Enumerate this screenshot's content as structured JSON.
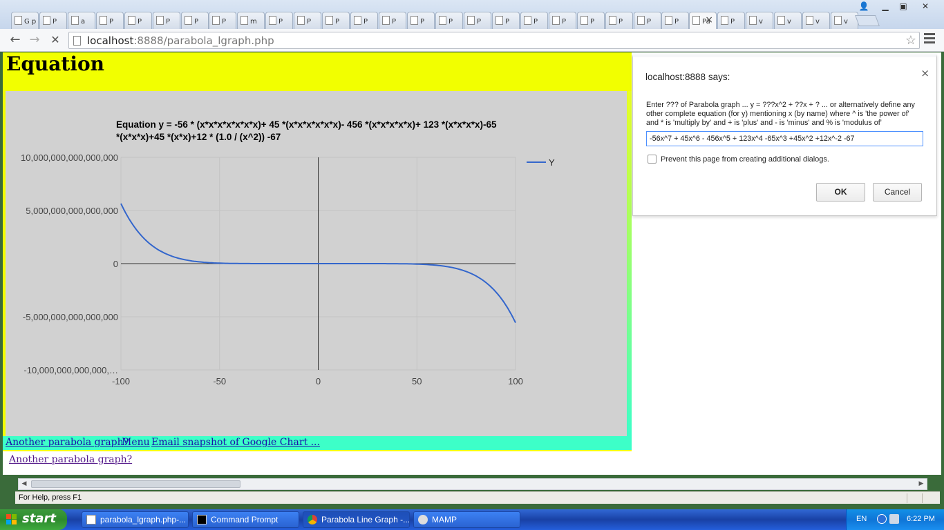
{
  "browser": {
    "tabs": [
      {
        "label": "G p"
      },
      {
        "label": "P"
      },
      {
        "label": "a"
      },
      {
        "label": "P"
      },
      {
        "label": "P"
      },
      {
        "label": "P"
      },
      {
        "label": "P"
      },
      {
        "label": "P"
      },
      {
        "label": "m"
      },
      {
        "label": "P"
      },
      {
        "label": "P"
      },
      {
        "label": "P"
      },
      {
        "label": "P"
      },
      {
        "label": "P"
      },
      {
        "label": "P"
      },
      {
        "label": "P"
      },
      {
        "label": "P"
      },
      {
        "label": "P"
      },
      {
        "label": "P"
      },
      {
        "label": "P"
      },
      {
        "label": "P"
      },
      {
        "label": "P"
      },
      {
        "label": "P"
      },
      {
        "label": "P"
      },
      {
        "label": "Pa"
      },
      {
        "label": "P"
      },
      {
        "label": "v"
      },
      {
        "label": "v"
      },
      {
        "label": "v"
      },
      {
        "label": "v"
      }
    ],
    "url_host": "localhost",
    "url_rest": ":8888/parabola_lgraph.php"
  },
  "page": {
    "title": "Equation",
    "links": {
      "another": "Another parabola graph?",
      "menu": "Menu",
      "email": "Email snapshot of Google Chart ...",
      "another_bottom": "Another parabola graph?"
    }
  },
  "chart_data": {
    "type": "line",
    "title_line1": "Equation y = -56 * (x*x*x*x*x*x*x)+ 45 *(x*x*x*x*x*x)- 456 *(x*x*x*x*x)+ 123 *(x*x*x*x)-65",
    "title_line2": "*(x*x*x)+45 *(x*x)+12 * (1.0 / (x^2)) -67",
    "x_ticks": [
      "-100",
      "-50",
      "0",
      "50",
      "100"
    ],
    "y_ticks": [
      "10,000,000,000,000,000",
      "5,000,000,000,000,000",
      "0",
      "-5,000,000,000,000,000",
      "-10,000,000,000,000,…"
    ],
    "xlim": [
      -100,
      100
    ],
    "ylim": [
      -10000000000000000,
      10000000000000000
    ],
    "legend_position": "right",
    "series": [
      {
        "name": "Y",
        "color": "#3366cc",
        "coefficients": {
          "x7": -56,
          "x6": 45,
          "x5": -456,
          "x4": 123,
          "x3": -65,
          "x2": 45,
          "xm2": 12,
          "c": -67
        },
        "x": [
          -100,
          -90,
          -80,
          -70,
          -60,
          -50,
          -40,
          -30,
          -20,
          -10,
          0,
          10,
          20,
          30,
          40,
          50,
          60,
          70,
          80,
          90,
          100
        ],
        "y": [
          5600000000000000.0,
          2690000000000000.0,
          1170000000000000.0,
          461000000000000.0,
          157000000000000.0,
          44500000000000.0,
          9300000000000.0,
          1260000000000.0,
          77300000000.0,
          606000000.0,
          -67,
          -516000000.0,
          -63000000000.0,
          -1140000000000.0,
          -8900000000000.0,
          -43100000000000.0,
          -155000000000000.0,
          -458000000000000.0,
          -1170000000000000.0,
          -2660000000000000.0,
          -5550000000000000.0
        ]
      }
    ]
  },
  "dialog": {
    "title": "localhost:8888 says:",
    "message": "Enter ??? of Parabola graph ... y = ???x^2 + ??x + ? ... or alternatively define any other complete equation (for y) mentioning x (by name) where ^ is 'the power of' and * is 'multiply by' and + is 'plus' and - is 'minus' and % is 'modulus of'",
    "input_value": "-56x^7 + 45x^6 - 456x^5 + 123x^4 -65x^3 +45x^2 +12x^-2 -67",
    "checkbox_label": "Prevent this page from creating additional dialogs.",
    "ok_label": "OK",
    "cancel_label": "Cancel",
    "close_glyph": "×"
  },
  "status": {
    "text": "For Help, press F1"
  },
  "taskbar": {
    "start_label": "start",
    "tasks": [
      {
        "label": "parabola_lgraph.php-..."
      },
      {
        "label": "Command Prompt"
      },
      {
        "label": "Parabola Line Graph -..."
      },
      {
        "label": "MAMP"
      }
    ],
    "lang": "EN",
    "clock": "6:22 PM"
  },
  "colors": {
    "page_yellow": "#f2ff00",
    "page_cyan": "#3dffc8",
    "chart_bg": "#d1d1d1",
    "series_blue": "#3366cc"
  }
}
